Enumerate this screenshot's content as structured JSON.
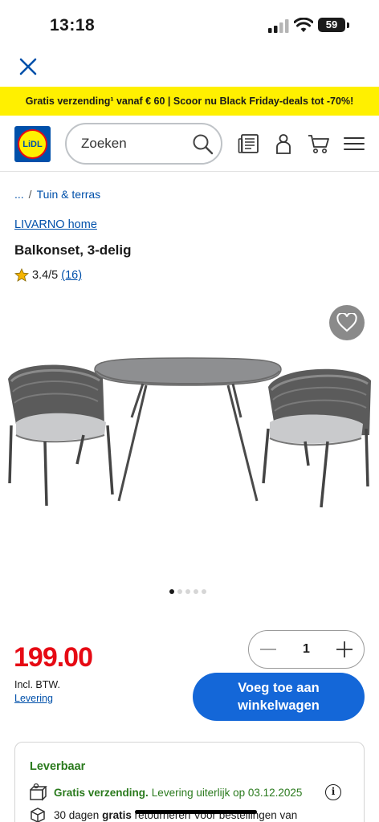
{
  "status_bar": {
    "time": "13:18",
    "battery": "59"
  },
  "promo": {
    "text": "Gratis verzending¹ vanaf € 60 | Scoor nu Black Friday-deals tot -70%!"
  },
  "header": {
    "logo_text": "LiDL",
    "search_placeholder": "Zoeken"
  },
  "breadcrumb": {
    "ellipsis": "...",
    "separator": "/",
    "category": "Tuin & terras"
  },
  "product": {
    "brand": "LIVARNO home",
    "title": "Balkonset, 3-delig",
    "rating": "3.4/5",
    "review_count": "(16)",
    "image_count": 5,
    "active_image": 1
  },
  "pricing": {
    "price": "199.00",
    "vat_note": "Incl. BTW.",
    "delivery_link": "Levering",
    "quantity": "1",
    "add_button_line1": "Voeg toe aan",
    "add_button_line2": "winkelwagen"
  },
  "availability": {
    "title": "Leverbaar",
    "shipping_bold": "Gratis verzending.",
    "shipping_rest": "Levering uiterlijk op 03.12.2025",
    "return_text_1": "30 dagen",
    "return_text_bold": "gratis",
    "return_text_2": "retourneren",
    "return_text_3": "Voor bestellingen van"
  },
  "colors": {
    "accent": "#0050aa",
    "price": "#e60a14",
    "banner": "#fff000",
    "button": "#1467d8",
    "available": "#2a7a1d"
  }
}
